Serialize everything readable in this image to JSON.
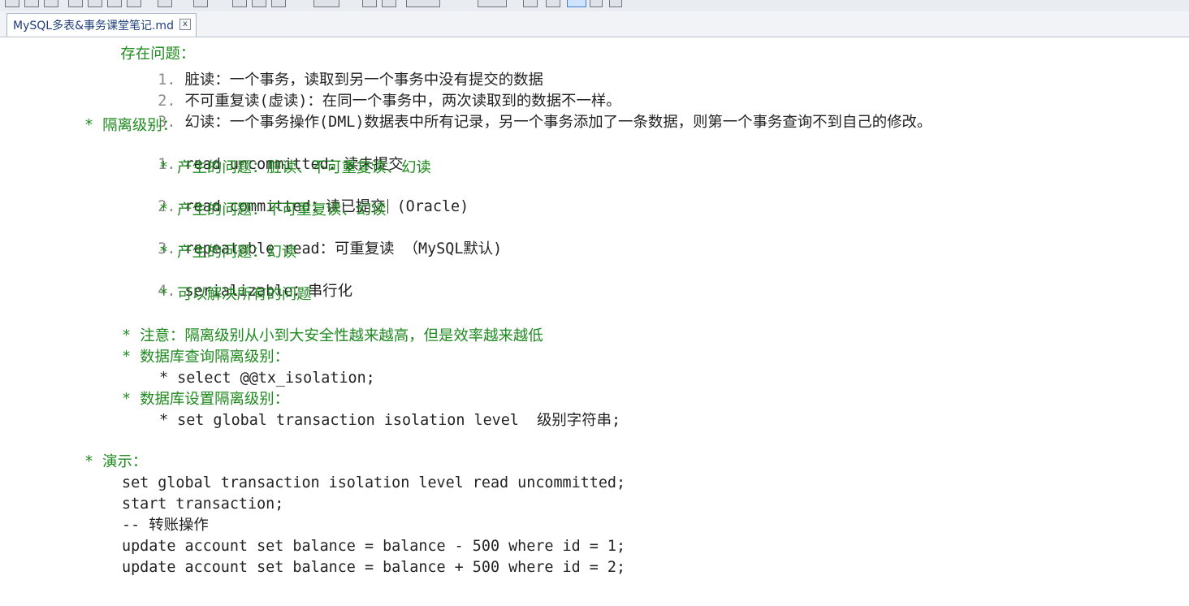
{
  "toolbar": {
    "icons": [
      "new-file-icon",
      "save-icon",
      "save-all-icon",
      "cut-icon",
      "paste-icon",
      "undo-icon",
      "redo-icon",
      "bold-icon",
      "italic-icon",
      "list-icon",
      "indent-icon",
      "outdent-icon",
      "find-icon",
      "replace-icon",
      "zoom-in-icon",
      "zoom-out-icon",
      "preview-icon",
      "export-icon"
    ]
  },
  "tab": {
    "label": "MySQL多表&事务课堂笔记.md",
    "close_label": "x"
  },
  "editor": {
    "top_cut": "存在问题：",
    "problems": {
      "n1": "1.",
      "t1": "脏读：一个事务，读取到另一个事务中没有提交的数据",
      "n2": "2.",
      "t2": "不可重复读(虚读)：在同一个事务中，两次读取到的数据不一样。",
      "n3": "3.",
      "t3": "幻读：一个事务操作(DML)数据表中所有记录，另一个事务添加了一条数据，则第一个事务查询不到自己的修改。"
    },
    "isolation_heading": "* 隔离级别：",
    "levels": [
      {
        "num": "1.",
        "text": "read uncommitted：读未提交",
        "sub": "* 产生的问题：脏读、不可重复读、幻读"
      },
      {
        "num": "2.",
        "text": "read committed：读已提交",
        "extra": "(Oracle)",
        "sub": "* 产生的问题：不可重复读、幻读"
      },
      {
        "num": "3.",
        "text": "repeatable read：可重复读 （MySQL默认)",
        "sub": "* 产生的问题：幻读"
      },
      {
        "num": "4.",
        "text": "serializable：串行化",
        "sub": "* 可以解决所有的问题"
      }
    ],
    "notes": {
      "note": "* 注意：隔离级别从小到大安全性越来越高，但是效率越来越低",
      "query_heading": "* 数据库查询隔离级别：",
      "query_sql": "* select @@tx_isolation;",
      "set_heading": "* 数据库设置隔离级别：",
      "set_sql": "* set global transaction isolation level  级别字符串;"
    },
    "demo": {
      "heading": "* 演示：",
      "lines": [
        "set global transaction isolation level read uncommitted;",
        "start transaction;",
        "-- 转账操作",
        "update account set balance = balance - 500 where id = 1;",
        "update account set balance = balance + 500 where id = 2;"
      ]
    }
  },
  "colors": {
    "text": "#232323",
    "bullet_green": "#1f8a1f",
    "tab_text": "#1e3f7a"
  }
}
